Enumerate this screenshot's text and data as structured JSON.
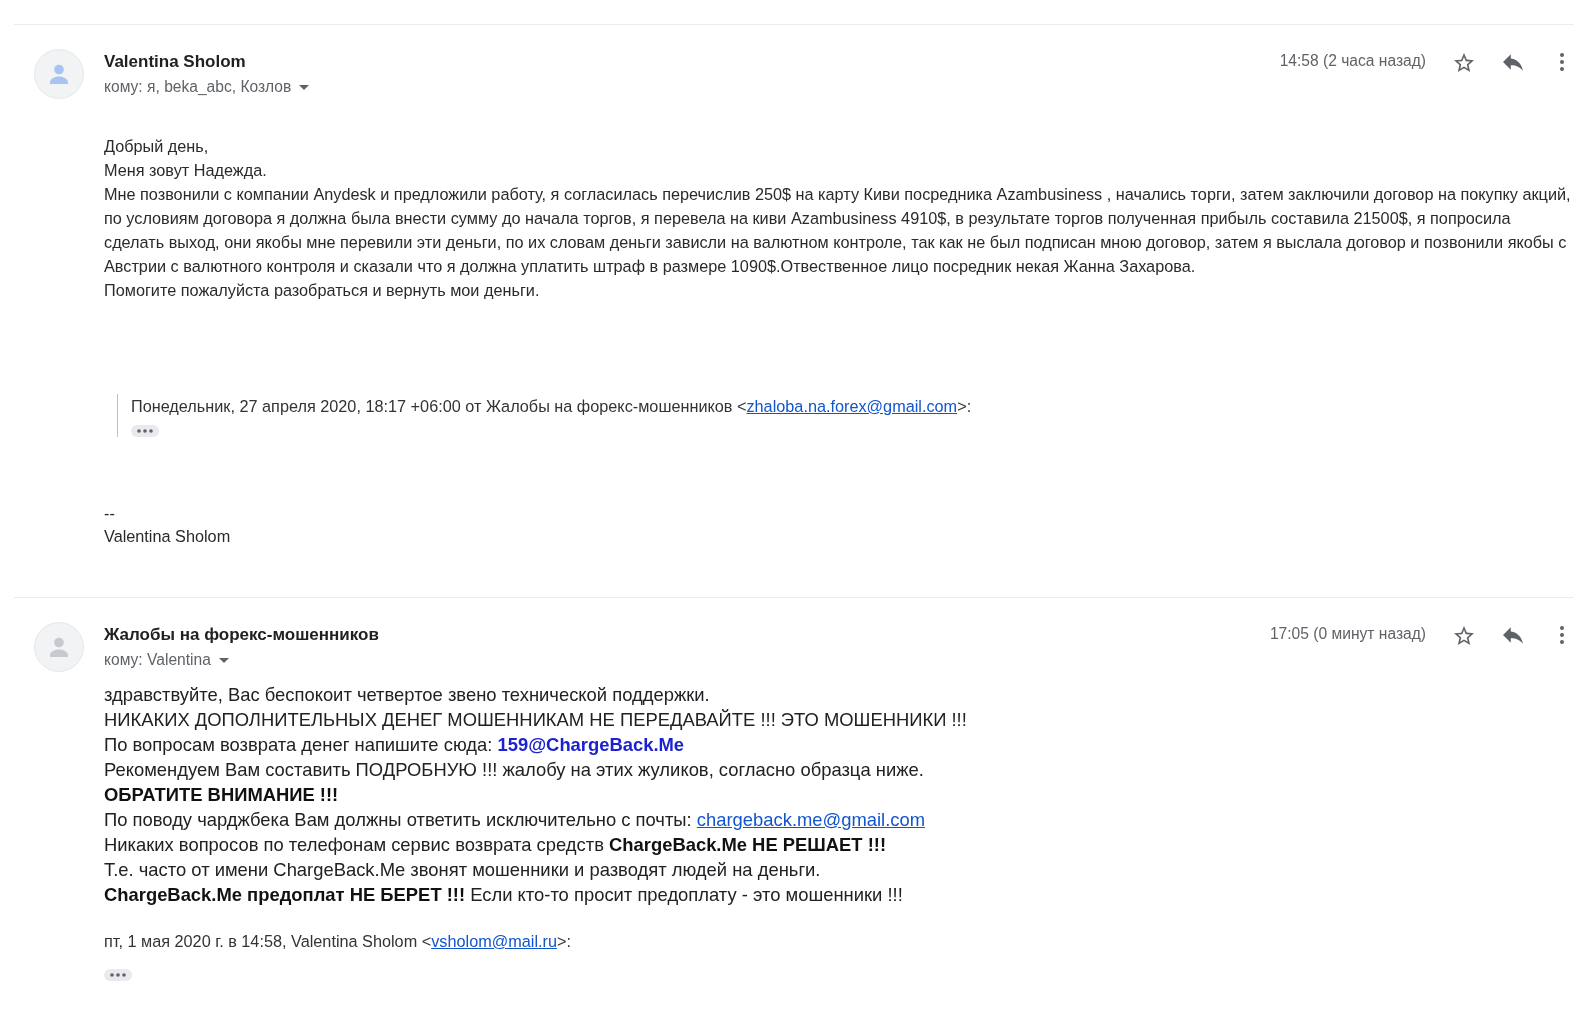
{
  "messages": [
    {
      "avatar": {
        "color": "#a9c4f2"
      },
      "sender": "Valentina Sholom",
      "recipients": "кому: я, beka_abc, Козлов",
      "time": "14:58 (2 часа назад)",
      "body": [
        {
          "kind": "plain",
          "text": "Добрый день,"
        },
        {
          "kind": "plain",
          "text": "Меня зовут Надежда."
        },
        {
          "kind": "plain",
          "text": "Мне позвонили с компании Anydesk и предложили работу, я согласилась перечислив 250$ на карту Киви посредника Azambusiness , начались торги, затем заключили договор на покупку акций, по условиям договора я должна была внести сумму до начала торгов, я перевела на киви Azambusiness 4910$, в результате торгов полученная прибыль составила 21500$, я попросила сделать выход, они якобы мне перевили эти деньги, по их словам деньги зависли на валютном контроле, так как не был подписан мною договор, затем я выслала договор и позвонили якобы с Австрии с валютного контроля и сказали что я должна уплатить штраф в размере 1090$.Отвественное лицо посредник некая Жанна Захарова."
        },
        {
          "kind": "plain",
          "text": "Помогите пожалуйста разобраться и вернуть мои деньги."
        },
        {
          "kind": "quote",
          "prefix": "Понедельник, 27 апреля 2020, 18:17 +06:00 от Жалобы на форекс-мошенников <",
          "email": "zhaloba.na.forex@gmail.com",
          "suffix": ">:"
        },
        {
          "kind": "signature",
          "separator": "--",
          "name": "Valentina Sholom"
        }
      ]
    },
    {
      "avatar": {
        "color": "#c6c9cd"
      },
      "sender": "Жалобы на форекс-мошенников",
      "recipients": "кому: Valentina",
      "time": "17:05 (0 минут назад)",
      "body": [
        {
          "kind": "rich",
          "text": "здравствуйте, Вас беспокоит четвертое звено технической поддержки."
        },
        {
          "kind": "rich",
          "text": "НИКАКИХ ДОПОЛНИТЕЛЬНЫХ ДЕНЕГ МОШЕННИКАМ НЕ ПЕРЕДАВАЙТЕ !!! ЭТО МОШЕННИКИ !!!"
        },
        {
          "kind": "contact",
          "text": "По вопросам возврата денег напишите сюда:",
          "address": "159@ChargeBack.Me"
        },
        {
          "kind": "rich",
          "text": "Рекомендуем Вам составить ПОДРОБНУЮ !!! жалобу на этих жуликов, согласно образца ниже."
        },
        {
          "kind": "heading",
          "text": "ОБРАТИТЕ ВНИМАНИЕ !!!"
        },
        {
          "kind": "mailto",
          "text": "По поводу чарджбека Вам должны ответить исключительно с почты:",
          "email": "chargeback.me@gmail.com"
        },
        {
          "kind": "rich",
          "text": "Никаких вопросов по телефонам сервис возврата средств **ChargeBack.Me НЕ РЕШАЕТ !!!**"
        },
        {
          "kind": "rich",
          "text": "Т.е. часто от имени ChargeBack.Me звонят мошенники и разводят людей на деньги."
        },
        {
          "kind": "rich",
          "text": "**ChargeBack.Me предоплат НЕ БЕРЕТ !!!** Если кто-то просит предоплату - это мошенники !!!"
        },
        {
          "kind": "attribution",
          "prefix": "пт, 1 мая 2020 г. в 14:58, Valentina Sholom <",
          "email": "vsholom@mail.ru",
          "suffix": ">:"
        }
      ]
    }
  ]
}
